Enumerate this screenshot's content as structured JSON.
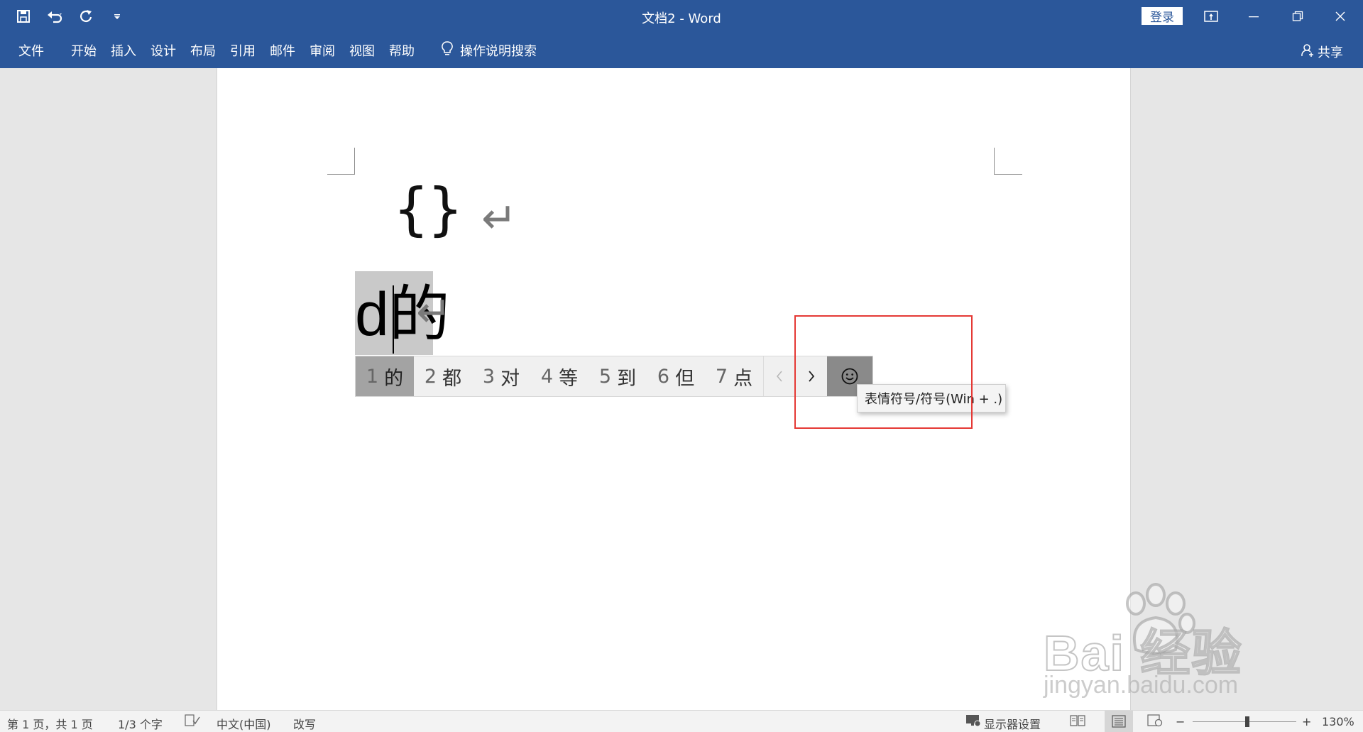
{
  "window": {
    "title": "文档2  -  Word",
    "login_label": "登录"
  },
  "ribbon": {
    "tabs": [
      "文件",
      "开始",
      "插入",
      "设计",
      "布局",
      "引用",
      "邮件",
      "审阅",
      "视图",
      "帮助"
    ],
    "tell_me": "操作说明搜索",
    "share": "共享"
  },
  "document": {
    "line1": "{}",
    "composition_text": "d的",
    "paragraph_mark": "↵"
  },
  "ime": {
    "candidates": [
      {
        "num": "1",
        "char": "的"
      },
      {
        "num": "2",
        "char": "都"
      },
      {
        "num": "3",
        "char": "对"
      },
      {
        "num": "4",
        "char": "等"
      },
      {
        "num": "5",
        "char": "到"
      },
      {
        "num": "6",
        "char": "但"
      },
      {
        "num": "7",
        "char": "点"
      }
    ],
    "selected_index": 0,
    "tooltip": "表情符号/符号(Win + .)"
  },
  "status_bar": {
    "page": "第 1 页，共 1 页",
    "words": "1/3 个字",
    "language": "中文(中国)",
    "mode": "改写",
    "display_settings": "显示器设置",
    "zoom": "130%"
  },
  "watermark": {
    "brand": "Bai  经验",
    "url": "jingyan.baidu.com"
  },
  "colors": {
    "ribbon": "#2b579a",
    "highlight": "#e53935",
    "selected_candidate": "#a3a3a3"
  }
}
